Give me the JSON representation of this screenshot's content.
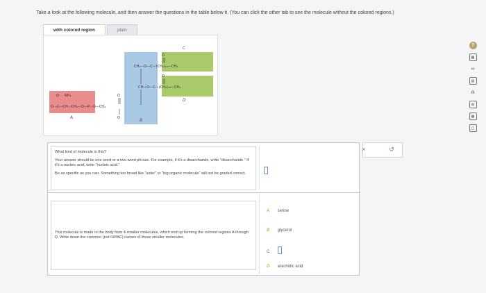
{
  "instructions": "Take a look at the following molecule, and then answer the questions in the table below it. (You can click the other tab to see the molecule without the colored regions.)",
  "tabs": [
    {
      "label": "with colored region",
      "active": true
    },
    {
      "label": "plain",
      "active": false
    }
  ],
  "molecule": {
    "region_labels": {
      "A": "A",
      "B": "B",
      "C": "C",
      "D": "D"
    },
    "colors": {
      "A": "#e98c8c",
      "B": "#a9c8e6",
      "C": "#a9c96b",
      "D": "#a9c96b"
    },
    "fragments": {
      "upper_chain": "CH₂—O—C—(CH₂)₁₆—CH₃",
      "middle_chain": "CH—O—C—(CH₂)₁₈—CH₃",
      "head": "O—C—CH—CH₂—O—P—O—CH₂",
      "nh3": "NH₃",
      "o": "O",
      "o_minus": "O"
    }
  },
  "question1": {
    "prompt": "What kind of molecule is this?",
    "hint1": "Your answer should be one word or a two-word phrase. For example, if it's a disaccharide, write \"disaccharide.\" If it's a nucleic acid, write \"nucleic acid.\"",
    "hint2": "Be as specific as you can. Something too broad like \"ester\" or \"big organic molecule\" will not be graded correct."
  },
  "question2": {
    "prompt": "This molecule is made in the body from 4 smaller molecules, which end up forming the colored regions A through D. Write down the common (not IUPAC) names of those smaller molecules.",
    "answers": [
      {
        "letter": "A",
        "value": "serine"
      },
      {
        "letter": "B",
        "value": "glycerol"
      },
      {
        "letter": "C",
        "value": ""
      },
      {
        "letter": "D",
        "value": "arachidic acid"
      }
    ]
  },
  "actions": {
    "clear": "×",
    "undo": "↺"
  },
  "toolbar": [
    {
      "icon": "help-icon",
      "glyph": "?"
    },
    {
      "icon": "calculator-icon",
      "glyph": "▦"
    },
    {
      "icon": "infinity-icon",
      "glyph": "∞"
    },
    {
      "icon": "table-icon",
      "glyph": "▤"
    },
    {
      "icon": "chart-icon",
      "glyph": "ılı"
    },
    {
      "icon": "ruler-icon",
      "glyph": "⊠"
    },
    {
      "icon": "grid-icon",
      "glyph": "▦"
    },
    {
      "icon": "book-icon",
      "glyph": "▢"
    }
  ]
}
